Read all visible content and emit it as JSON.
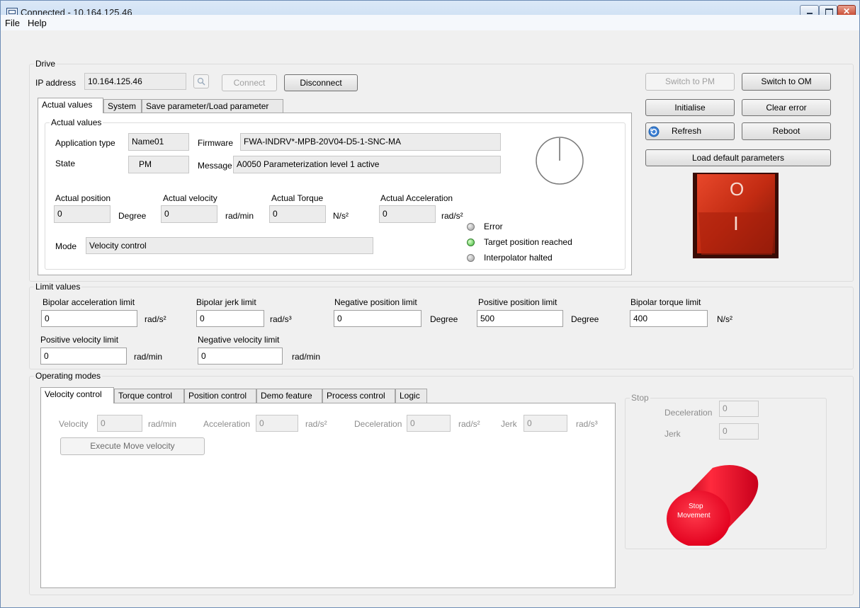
{
  "window": {
    "title": "Connected - 10.164.125.46",
    "close_glyph": "✕"
  },
  "menu": [
    "File",
    "Help"
  ],
  "drive": {
    "caption": "Drive",
    "ip_label": "IP address",
    "ip_value": "10.164.125.46",
    "connect": "Connect",
    "disconnect": "Disconnect",
    "switch_pm": "Switch to PM",
    "switch_om": "Switch to OM",
    "initialise": "Initialise",
    "clear_error": "Clear error",
    "refresh": "Refresh",
    "reboot": "Reboot",
    "load_default": "Load default parameters",
    "switch_symbols": {
      "top": "O",
      "bottom": "I"
    },
    "tabs": [
      "Actual values",
      "System",
      "Save parameter/Load parameter"
    ]
  },
  "actual_values": {
    "caption": "Actual values",
    "application_type_label": "Application type",
    "application_type": "Name01",
    "firmware_label": "Firmware",
    "firmware": "FWA-INDRV*-MPB-20V04-D5-1-SNC-MA",
    "state_label": "State",
    "state": "PM",
    "message_label": "Message",
    "message": "A0050 Parameterization level 1 active",
    "position_label": "Actual position",
    "position": "0",
    "position_unit": "Degree",
    "velocity_label": "Actual velocity",
    "velocity": "0",
    "velocity_unit": "rad/min",
    "torque_label": "Actual Torque",
    "torque": "0",
    "torque_unit": "N/s²",
    "accel_label": "Actual Acceleration",
    "accel": "0",
    "accel_unit": "rad/s²",
    "mode_label": "Mode",
    "mode": "Velocity control",
    "indicators": [
      {
        "label": "Error",
        "state": "off"
      },
      {
        "label": "Target position reached",
        "state": "on"
      },
      {
        "label": "Interpolator halted",
        "state": "off"
      }
    ]
  },
  "limits": {
    "caption": "Limit values",
    "bipolar_accel_label": "Bipolar acceleration limit",
    "bipolar_accel": "0",
    "bipolar_accel_unit": "rad/s²",
    "bipolar_jerk_label": "Bipolar jerk limit",
    "bipolar_jerk": "0",
    "bipolar_jerk_unit": "rad/s³",
    "neg_pos_label": "Negative position limit",
    "neg_pos": "0",
    "neg_pos_unit": "Degree",
    "pos_pos_label": "Positive position limit",
    "pos_pos": "500",
    "pos_pos_unit": "Degree",
    "torque_label": "Bipolar torque limit",
    "torque": "400",
    "torque_unit": "N/s²",
    "pos_vel_label": "Positive velocity limit",
    "pos_vel": "0",
    "pos_vel_unit": "rad/min",
    "neg_vel_label": "Negative velocity limit",
    "neg_vel": "0",
    "neg_vel_unit": "rad/min"
  },
  "operating": {
    "caption": "Operating modes",
    "tabs": [
      "Velocity control",
      "Torque control",
      "Position control",
      "Demo feature",
      "Process control",
      "Logic"
    ],
    "velocity_label": "Velocity",
    "velocity": "0",
    "velocity_unit": "rad/min",
    "accel_label": "Acceleration",
    "accel": "0",
    "accel_unit": "rad/s²",
    "decel_label": "Deceleration",
    "decel": "0",
    "decel_unit": "rad/s²",
    "jerk_label": "Jerk",
    "jerk": "0",
    "jerk_unit": "rad/s³",
    "execute": "Execute Move velocity"
  },
  "stop": {
    "caption": "Stop",
    "decel_label": "Deceleration",
    "decel": "0",
    "jerk_label": "Jerk",
    "jerk": "0",
    "button_line1": "Stop",
    "button_line2": "Movement"
  }
}
